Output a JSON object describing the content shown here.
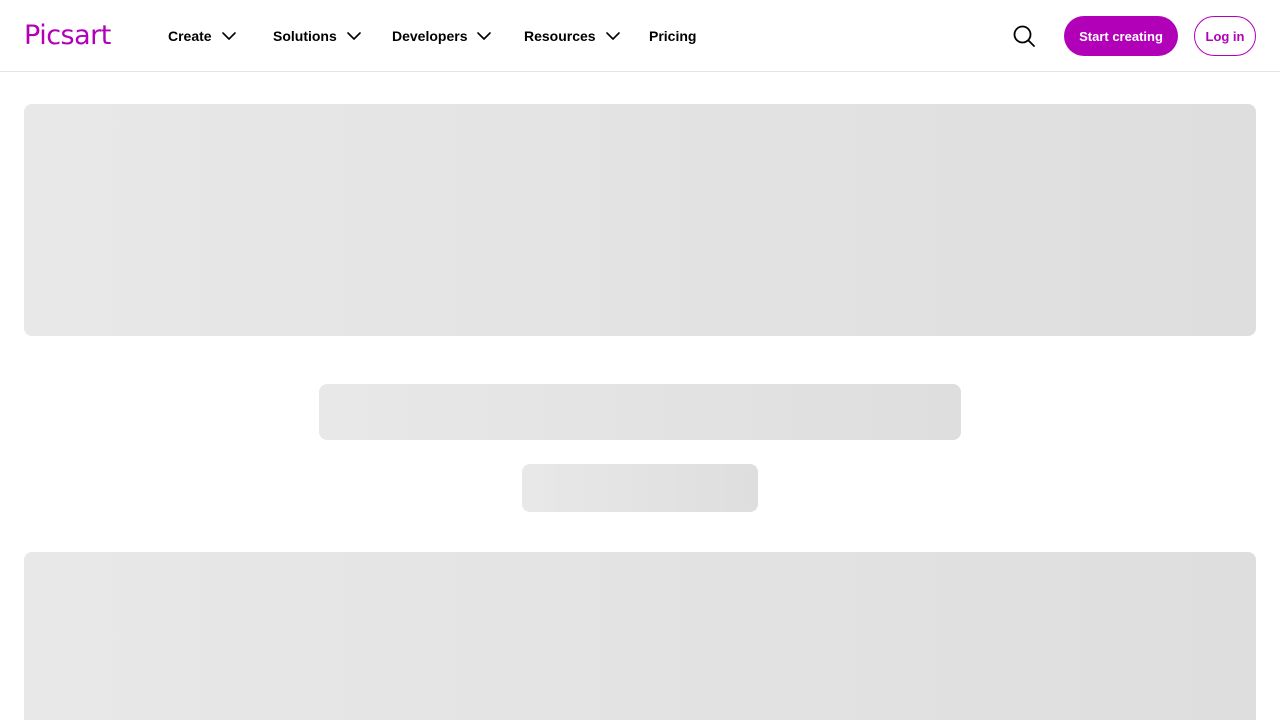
{
  "brand": {
    "name": "Picsart",
    "color": "#b100b8"
  },
  "nav": {
    "items": [
      {
        "label": "Create",
        "has_dropdown": true
      },
      {
        "label": "Solutions",
        "has_dropdown": true
      },
      {
        "label": "Developers",
        "has_dropdown": true
      },
      {
        "label": "Resources",
        "has_dropdown": true
      },
      {
        "label": "Pricing",
        "has_dropdown": false
      }
    ]
  },
  "actions": {
    "search_icon": "search-icon",
    "start_label": "Start creating",
    "login_label": "Log in"
  },
  "colors": {
    "accent": "#b100b8",
    "skeleton_start": "#e8e8e8",
    "skeleton_end": "#dedede",
    "divider": "#e4e4e4"
  },
  "content_state": "loading"
}
